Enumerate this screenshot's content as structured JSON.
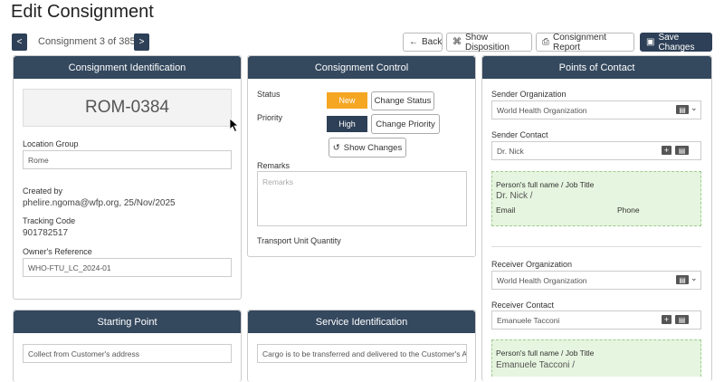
{
  "page": {
    "title": "Edit Consignment"
  },
  "nav": {
    "prev": "<",
    "next": ">",
    "position": "Consignment 3 of 385"
  },
  "toolbar": {
    "back": "Back",
    "show_disposition": "Show Disposition",
    "consignment_report": "Consignment Report",
    "save_changes": "Save Changes"
  },
  "identification": {
    "heading": "Consignment Identification",
    "code": "ROM-0384",
    "location_group_label": "Location Group",
    "location_group_value": "Rome",
    "created_by_label": "Created by",
    "created_by_value": "phelire.ngoma@wfp.org, 25/Nov/2025",
    "tracking_label": "Tracking Code",
    "tracking_value": "901782517",
    "owners_ref_label": "Owner's Reference",
    "owners_ref_value": "WHO-FTU_LC_2024-01"
  },
  "control": {
    "heading": "Consignment Control",
    "status_label": "Status",
    "status_value": "New",
    "change_status": "Change Status",
    "priority_label": "Priority",
    "priority_value": "High",
    "change_priority": "Change Priority",
    "show_changes": "Show Changes",
    "remarks_label": "Remarks",
    "remarks_placeholder": "Remarks",
    "tuq_label": "Transport Unit Quantity"
  },
  "contacts": {
    "heading": "Points of Contact",
    "sender_org_label": "Sender Organization",
    "sender_org_value": "World Health Organization",
    "sender_contact_label": "Sender Contact",
    "sender_contact_value": "Dr. Nick",
    "sender_card_title": "Person's full name / Job Title",
    "sender_card_name": "Dr. Nick /",
    "email_label": "Email",
    "phone_label": "Phone",
    "receiver_org_label": "Receiver Organization",
    "receiver_org_value": "World Health Organization",
    "receiver_contact_label": "Receiver Contact",
    "receiver_contact_value": "Emanuele Tacconi",
    "receiver_card_title": "Person's full name / Job Title",
    "receiver_card_name": "Emanuele Tacconi /"
  },
  "starting_point": {
    "heading": "Starting Point",
    "value": "Collect from Customer's address"
  },
  "service": {
    "heading": "Service Identification",
    "value": "Cargo is to be transferred and delivered to the Customer's Ad"
  },
  "colors": {
    "header": "#34485e",
    "status_new": "#f5a623",
    "priority_high": "#2e4057",
    "contact_card": "#e6f5df"
  }
}
